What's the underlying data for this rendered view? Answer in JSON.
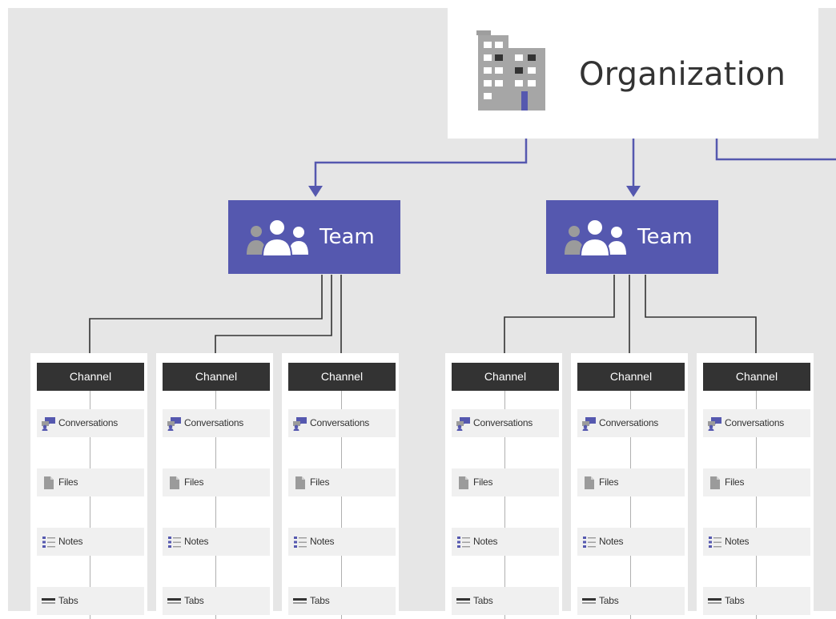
{
  "organization": {
    "label": "Organization",
    "icon": "building-icon"
  },
  "teams": [
    {
      "label": "Team",
      "icon": "people-icon"
    },
    {
      "label": "Team",
      "icon": "people-icon"
    }
  ],
  "channel_label": "Channel",
  "channel_items": [
    {
      "label": "Conversations",
      "icon": "conversations-icon"
    },
    {
      "label": "Files",
      "icon": "file-icon"
    },
    {
      "label": "Notes",
      "icon": "notes-icon"
    },
    {
      "label": "Tabs",
      "icon": "tabs-icon"
    }
  ],
  "colors": {
    "team": "#5558af",
    "arrow": "#5558af",
    "channel_header": "#333333",
    "background": "#e6e6e6",
    "item_background": "#f0f0f0"
  }
}
